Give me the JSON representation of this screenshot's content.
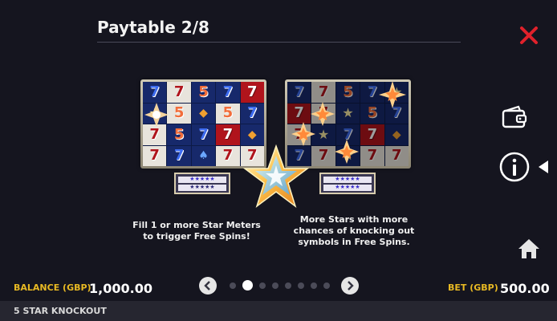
{
  "header": {
    "title": "Paytable 2/8"
  },
  "icons": {
    "close": "close-icon",
    "wallet": "wallet-icon",
    "info": "info-icon",
    "info_pointer": "triangle-left-icon",
    "home": "home-icon",
    "prev": "chevron-left-icon",
    "next": "chevron-right-icon",
    "centre_star": "star-icon"
  },
  "colors": {
    "close": "#e0212b",
    "accent_label": "#e8b923",
    "background": "#15151f"
  },
  "reels_left": {
    "rows": [
      [
        {
          "s": "7",
          "bg": "navy",
          "fg": "s7"
        },
        {
          "s": "7",
          "bg": "white",
          "fg": "s7w"
        },
        {
          "s": "5",
          "bg": "navy",
          "fg": "s5"
        },
        {
          "s": "7",
          "bg": "navy",
          "fg": "s7"
        },
        {
          "s": "7",
          "bg": "red",
          "fg": "s7r"
        }
      ],
      [
        {
          "s": "★",
          "bg": "navy",
          "fg": "sstar"
        },
        {
          "s": "5",
          "bg": "white",
          "fg": "s5"
        },
        {
          "s": "◆",
          "bg": "navy",
          "fg": "sd"
        },
        {
          "s": "5",
          "bg": "white",
          "fg": "s5"
        },
        {
          "s": "7",
          "bg": "navy",
          "fg": "s7"
        }
      ],
      [
        {
          "s": "7",
          "bg": "white",
          "fg": "s7w"
        },
        {
          "s": "5",
          "bg": "navy",
          "fg": "s5"
        },
        {
          "s": "7",
          "bg": "navy",
          "fg": "s7"
        },
        {
          "s": "7",
          "bg": "red",
          "fg": "s7r"
        },
        {
          "s": "◆",
          "bg": "navy",
          "fg": "sd"
        }
      ],
      [
        {
          "s": "7",
          "bg": "white",
          "fg": "s7w"
        },
        {
          "s": "7",
          "bg": "navy",
          "fg": "s7"
        },
        {
          "s": "♠",
          "bg": "navy",
          "fg": "ss"
        },
        {
          "s": "7",
          "bg": "white",
          "fg": "s7w"
        },
        {
          "s": "7",
          "bg": "white",
          "fg": "s7w"
        }
      ]
    ]
  },
  "reels_right": {
    "rows": [
      [
        {
          "s": "7",
          "bg": "navy",
          "fg": "s7"
        },
        {
          "s": "7",
          "bg": "white",
          "fg": "s7w"
        },
        {
          "s": "5",
          "bg": "navy",
          "fg": "s5"
        },
        {
          "s": "7",
          "bg": "navy",
          "fg": "s7"
        },
        {
          "s": "★",
          "bg": "navy",
          "fg": "sstar"
        }
      ],
      [
        {
          "s": "7",
          "bg": "red",
          "fg": "s7r"
        },
        {
          "s": "7",
          "bg": "white",
          "fg": "s7w"
        },
        {
          "s": "★",
          "bg": "navy",
          "fg": "sstar"
        },
        {
          "s": "5",
          "bg": "navy",
          "fg": "s5"
        },
        {
          "s": "7",
          "bg": "navy",
          "fg": "s7"
        }
      ],
      [
        {
          "s": "7",
          "bg": "white",
          "fg": "s7w"
        },
        {
          "s": "★",
          "bg": "navy",
          "fg": "sstar"
        },
        {
          "s": "7",
          "bg": "navy",
          "fg": "s7"
        },
        {
          "s": "7",
          "bg": "red",
          "fg": "s7r"
        },
        {
          "s": "◆",
          "bg": "navy",
          "fg": "sd"
        }
      ],
      [
        {
          "s": "7",
          "bg": "navy",
          "fg": "s7"
        },
        {
          "s": "7",
          "bg": "white",
          "fg": "s7w"
        },
        {
          "s": "★",
          "bg": "navy",
          "fg": "sstar"
        },
        {
          "s": "7",
          "bg": "white",
          "fg": "s7w"
        },
        {
          "s": "7",
          "bg": "white",
          "fg": "s7w"
        }
      ]
    ]
  },
  "meters": {
    "left": {
      "filled_rows": 1
    },
    "right": {
      "filled_rows": 2
    }
  },
  "descriptions": {
    "left": "Fill 1 or more Star Meters to trigger Free Spins!",
    "right": "More Stars with more chances of knocking out symbols in Free Spins."
  },
  "footer": {
    "balance_label": "BALANCE (GBP)",
    "balance_value": "1,000.00",
    "bet_label": "BET (GBP)",
    "bet_value": "500.00"
  },
  "pagination": {
    "total": 8,
    "current": 2
  },
  "game": {
    "name": "5 STAR KNOCKOUT"
  }
}
